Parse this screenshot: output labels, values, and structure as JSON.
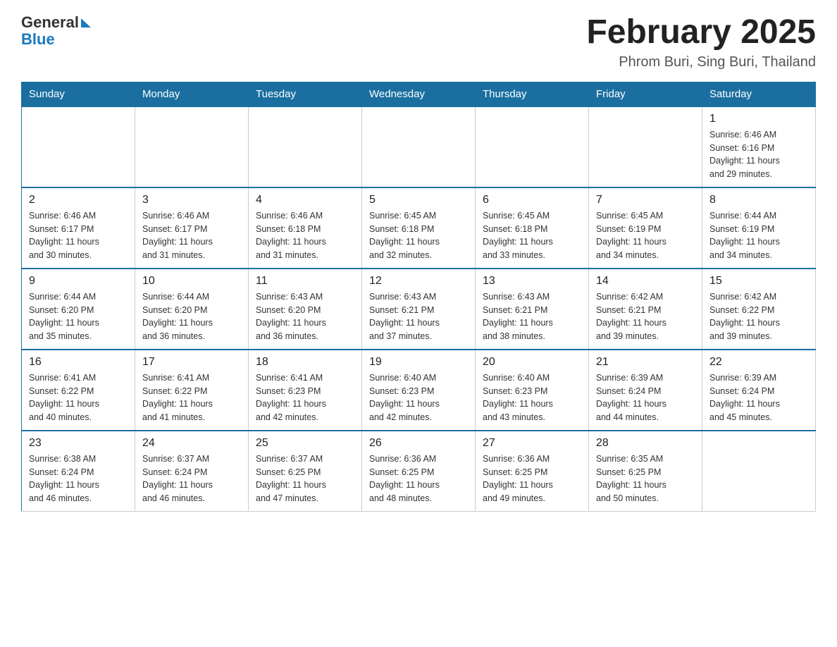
{
  "header": {
    "logo_general": "General",
    "logo_blue": "Blue",
    "month_title": "February 2025",
    "location": "Phrom Buri, Sing Buri, Thailand"
  },
  "weekdays": [
    "Sunday",
    "Monday",
    "Tuesday",
    "Wednesday",
    "Thursday",
    "Friday",
    "Saturday"
  ],
  "weeks": [
    [
      {
        "day": "",
        "info": ""
      },
      {
        "day": "",
        "info": ""
      },
      {
        "day": "",
        "info": ""
      },
      {
        "day": "",
        "info": ""
      },
      {
        "day": "",
        "info": ""
      },
      {
        "day": "",
        "info": ""
      },
      {
        "day": "1",
        "info": "Sunrise: 6:46 AM\nSunset: 6:16 PM\nDaylight: 11 hours\nand 29 minutes."
      }
    ],
    [
      {
        "day": "2",
        "info": "Sunrise: 6:46 AM\nSunset: 6:17 PM\nDaylight: 11 hours\nand 30 minutes."
      },
      {
        "day": "3",
        "info": "Sunrise: 6:46 AM\nSunset: 6:17 PM\nDaylight: 11 hours\nand 31 minutes."
      },
      {
        "day": "4",
        "info": "Sunrise: 6:46 AM\nSunset: 6:18 PM\nDaylight: 11 hours\nand 31 minutes."
      },
      {
        "day": "5",
        "info": "Sunrise: 6:45 AM\nSunset: 6:18 PM\nDaylight: 11 hours\nand 32 minutes."
      },
      {
        "day": "6",
        "info": "Sunrise: 6:45 AM\nSunset: 6:18 PM\nDaylight: 11 hours\nand 33 minutes."
      },
      {
        "day": "7",
        "info": "Sunrise: 6:45 AM\nSunset: 6:19 PM\nDaylight: 11 hours\nand 34 minutes."
      },
      {
        "day": "8",
        "info": "Sunrise: 6:44 AM\nSunset: 6:19 PM\nDaylight: 11 hours\nand 34 minutes."
      }
    ],
    [
      {
        "day": "9",
        "info": "Sunrise: 6:44 AM\nSunset: 6:20 PM\nDaylight: 11 hours\nand 35 minutes."
      },
      {
        "day": "10",
        "info": "Sunrise: 6:44 AM\nSunset: 6:20 PM\nDaylight: 11 hours\nand 36 minutes."
      },
      {
        "day": "11",
        "info": "Sunrise: 6:43 AM\nSunset: 6:20 PM\nDaylight: 11 hours\nand 36 minutes."
      },
      {
        "day": "12",
        "info": "Sunrise: 6:43 AM\nSunset: 6:21 PM\nDaylight: 11 hours\nand 37 minutes."
      },
      {
        "day": "13",
        "info": "Sunrise: 6:43 AM\nSunset: 6:21 PM\nDaylight: 11 hours\nand 38 minutes."
      },
      {
        "day": "14",
        "info": "Sunrise: 6:42 AM\nSunset: 6:21 PM\nDaylight: 11 hours\nand 39 minutes."
      },
      {
        "day": "15",
        "info": "Sunrise: 6:42 AM\nSunset: 6:22 PM\nDaylight: 11 hours\nand 39 minutes."
      }
    ],
    [
      {
        "day": "16",
        "info": "Sunrise: 6:41 AM\nSunset: 6:22 PM\nDaylight: 11 hours\nand 40 minutes."
      },
      {
        "day": "17",
        "info": "Sunrise: 6:41 AM\nSunset: 6:22 PM\nDaylight: 11 hours\nand 41 minutes."
      },
      {
        "day": "18",
        "info": "Sunrise: 6:41 AM\nSunset: 6:23 PM\nDaylight: 11 hours\nand 42 minutes."
      },
      {
        "day": "19",
        "info": "Sunrise: 6:40 AM\nSunset: 6:23 PM\nDaylight: 11 hours\nand 42 minutes."
      },
      {
        "day": "20",
        "info": "Sunrise: 6:40 AM\nSunset: 6:23 PM\nDaylight: 11 hours\nand 43 minutes."
      },
      {
        "day": "21",
        "info": "Sunrise: 6:39 AM\nSunset: 6:24 PM\nDaylight: 11 hours\nand 44 minutes."
      },
      {
        "day": "22",
        "info": "Sunrise: 6:39 AM\nSunset: 6:24 PM\nDaylight: 11 hours\nand 45 minutes."
      }
    ],
    [
      {
        "day": "23",
        "info": "Sunrise: 6:38 AM\nSunset: 6:24 PM\nDaylight: 11 hours\nand 46 minutes."
      },
      {
        "day": "24",
        "info": "Sunrise: 6:37 AM\nSunset: 6:24 PM\nDaylight: 11 hours\nand 46 minutes."
      },
      {
        "day": "25",
        "info": "Sunrise: 6:37 AM\nSunset: 6:25 PM\nDaylight: 11 hours\nand 47 minutes."
      },
      {
        "day": "26",
        "info": "Sunrise: 6:36 AM\nSunset: 6:25 PM\nDaylight: 11 hours\nand 48 minutes."
      },
      {
        "day": "27",
        "info": "Sunrise: 6:36 AM\nSunset: 6:25 PM\nDaylight: 11 hours\nand 49 minutes."
      },
      {
        "day": "28",
        "info": "Sunrise: 6:35 AM\nSunset: 6:25 PM\nDaylight: 11 hours\nand 50 minutes."
      },
      {
        "day": "",
        "info": ""
      }
    ]
  ]
}
